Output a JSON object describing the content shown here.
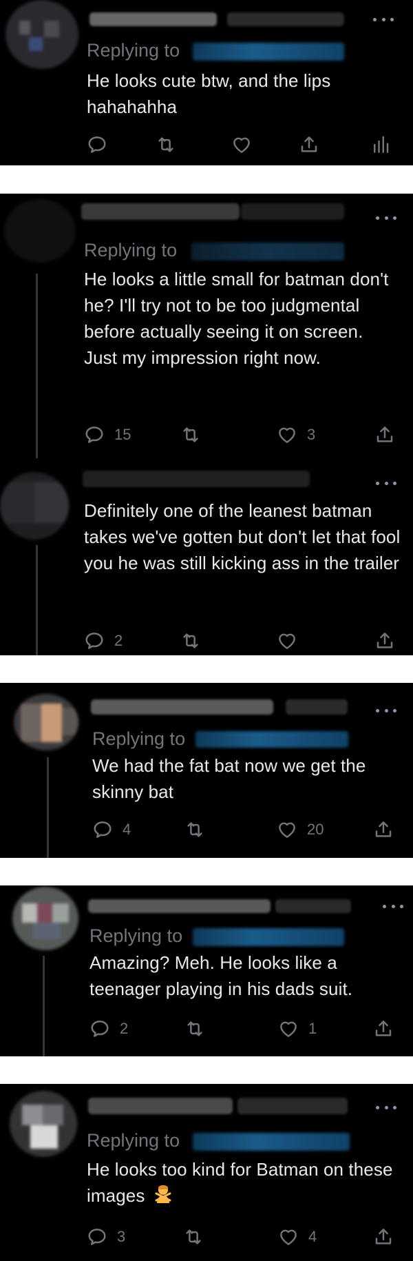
{
  "replying_to_label": "Replying to",
  "colors": {
    "background": "#000000",
    "separator": "#ffffff",
    "text": "#e7e9ea",
    "muted": "#71767b",
    "mention_blue": "#1d9bf0"
  },
  "icons": {
    "reply": "reply-icon",
    "retweet": "retweet-icon",
    "like": "heart-icon",
    "share": "share-icon",
    "analytics": "analytics-icon",
    "more": "more-icon"
  },
  "tweets": [
    {
      "text": "He looks cute btw, and the lips hahahahha",
      "reply_count": "",
      "retweet_count": "",
      "like_count": ""
    },
    {
      "text": "He looks a little small for batman don't he? I'll try not to be too judgmental before actually seeing it on screen. Just my impression right now.",
      "reply_count": "15",
      "retweet_count": "",
      "like_count": "3"
    },
    {
      "text": "Definitely one of the leanest batman takes we've gotten but don't let that fool you he was still kicking ass in the trailer",
      "reply_count": "2",
      "retweet_count": "",
      "like_count": ""
    },
    {
      "text": "We had the fat bat now we get the skinny bat",
      "reply_count": "4",
      "retweet_count": "",
      "like_count": "20"
    },
    {
      "text": "Amazing? Meh. He looks like a teenager playing in his dads suit.",
      "reply_count": "2",
      "retweet_count": "",
      "like_count": "1"
    },
    {
      "text": "He looks too kind for Batman on these images",
      "emoji": "person-gesturing-no-emoji",
      "reply_count": "3",
      "retweet_count": "",
      "like_count": "4"
    }
  ]
}
